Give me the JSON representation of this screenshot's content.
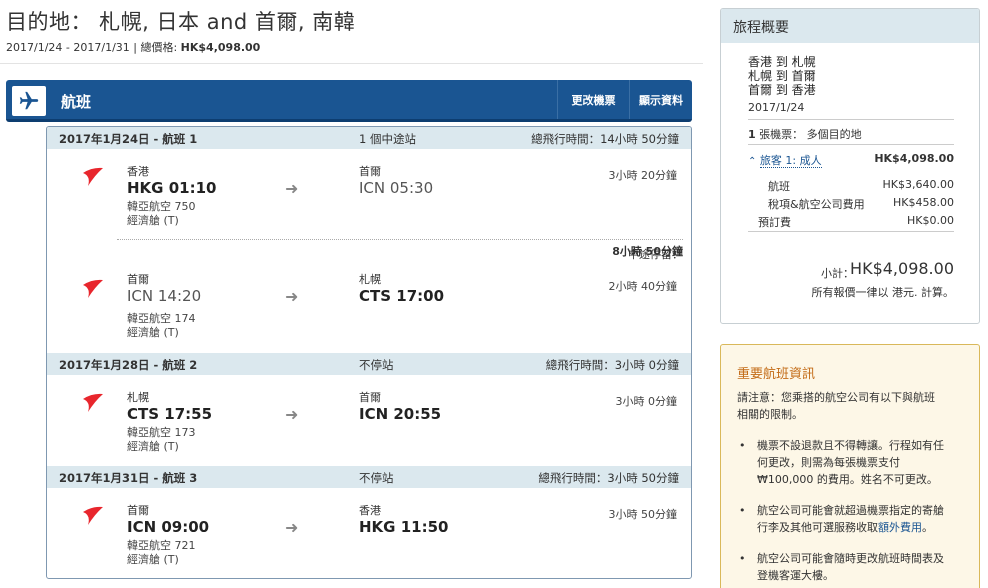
{
  "header": {
    "title": "目的地： 札幌, 日本 and 首爾, 南韓",
    "dates": "2017/1/24 - 2017/1/31 | 總價格:",
    "total_price": "HK$4,098.00"
  },
  "flight_bar": {
    "title": "航班",
    "change_label": "更改機票",
    "show_label": "顯示資料"
  },
  "segments": [
    {
      "date_label": "2017年1月24日 - 航班 1",
      "stops": "1 個中途站",
      "total": "總飛行時間：14小時 50分鐘",
      "legs": [
        {
          "from_city": "香港",
          "from_code": "HKG 01:10",
          "to_city": "首爾",
          "to_code": "ICN 05:30",
          "flight": "韓亞航空 750",
          "cabin": "經濟艙 (T)",
          "duration": "3小時 20分鐘"
        },
        {
          "from_city": "首爾",
          "from_code": "ICN 14:20",
          "to_city": "札幌",
          "to_code": "CTS 17:00",
          "flight": "韓亞航空 174",
          "cabin": "經濟艙 (T)",
          "duration": "2小時 40分鐘"
        }
      ],
      "layover_label": "中途停留：",
      "layover_value": "8小時 50分鐘"
    },
    {
      "date_label": "2017年1月28日 - 航班 2",
      "stops": "不停站",
      "total": "總飛行時間：3小時 0分鐘",
      "legs": [
        {
          "from_city": "札幌",
          "from_code": "CTS 17:55",
          "to_city": "首爾",
          "to_code": "ICN 20:55",
          "flight": "韓亞航空 173",
          "cabin": "經濟艙 (T)",
          "duration": "3小時 0分鐘"
        }
      ]
    },
    {
      "date_label": "2017年1月31日 - 航班 3",
      "stops": "不停站",
      "total": "總飛行時間：3小時 50分鐘",
      "legs": [
        {
          "from_city": "首爾",
          "from_code": "ICN 09:00",
          "to_city": "香港",
          "to_code": "HKG 11:50",
          "flight": "韓亞航空 721",
          "cabin": "經濟艙 (T)",
          "duration": "3小時 50分鐘"
        }
      ]
    }
  ],
  "summary": {
    "title": "旅程概要",
    "routes": [
      "香港 到 札幌",
      "札幌 到 首爾",
      "首爾 到 香港"
    ],
    "date": "2017/1/24",
    "ticket_count": "1",
    "ticket_label": "張機票： 多個目的地",
    "traveler_label": "旅客 1: 成人",
    "traveler_price": "HK$4,098.00",
    "flight_label": "航班",
    "flight_price": "HK$3,640.00",
    "tax_label": "稅項&航空公司費用",
    "tax_price": "HK$458.00",
    "booking_label": "預訂費",
    "booking_price": "HK$0.00",
    "subtotal_label": "小計：",
    "subtotal_value": "HK$4,098.00",
    "currency_note": "所有報價一律以 港元. 計算。"
  },
  "important": {
    "title": "重要航班資訊",
    "intro": [
      "請注意：您乘搭的航空公司有以下與航班",
      "相關的限制。"
    ],
    "bullets": [
      [
        "機票不設退款且不得轉讓。行程如有任",
        "何更改，則需為每張機票支付",
        "₩100,000 的費用。姓名不可更改。"
      ],
      [
        "航空公司可能會就超過機票指定的寄艙",
        "行李及其他可選服務收取"
      ],
      [
        "航空公司可能會隨時更改航班時間表及",
        "登機客運大樓。"
      ]
    ],
    "fee_link": "額外費用",
    "fee_suffix": "。"
  },
  "colors": {
    "bar": "#1a5592",
    "segment_head": "#dbe8ee",
    "airline": "#e8262d",
    "important_title": "#c36b16"
  }
}
